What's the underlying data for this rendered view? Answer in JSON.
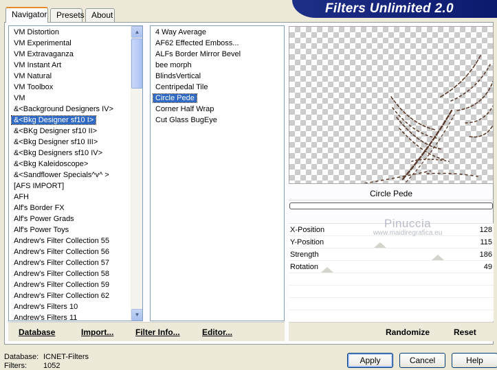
{
  "tabs": [
    {
      "label": "Navigator",
      "active": true
    },
    {
      "label": "Presets",
      "active": false
    },
    {
      "label": "About",
      "active": false
    }
  ],
  "banner": {
    "title": "Filters Unlimited 2.0"
  },
  "categories": [
    {
      "label": "VM Distortion"
    },
    {
      "label": "VM Experimental"
    },
    {
      "label": "VM Extravaganza"
    },
    {
      "label": "VM Instant Art"
    },
    {
      "label": "VM Natural"
    },
    {
      "label": "VM Toolbox"
    },
    {
      "label": "VM"
    },
    {
      "label": "&<Background Designers IV>"
    },
    {
      "label": "&<Bkg Designer sf10 I>",
      "selected": true
    },
    {
      "label": "&<BKg Designer sf10 II>"
    },
    {
      "label": "&<Bkg Designer sf10 III>"
    },
    {
      "label": "&<Bkg Designers sf10 IV>"
    },
    {
      "label": "&<Bkg Kaleidoscope>"
    },
    {
      "label": "&<Sandflower Specials^v^ >"
    },
    {
      "label": "[AFS IMPORT]"
    },
    {
      "label": "AFH"
    },
    {
      "label": "Alf's Border FX"
    },
    {
      "label": "Alf's Power Grads"
    },
    {
      "label": "Alf's Power Toys"
    },
    {
      "label": "Andrew's Filter Collection 55"
    },
    {
      "label": "Andrew's Filter Collection 56"
    },
    {
      "label": "Andrew's Filter Collection 57"
    },
    {
      "label": "Andrew's Filter Collection 58"
    },
    {
      "label": "Andrew's Filter Collection 59"
    },
    {
      "label": "Andrew's Filter Collection 62"
    },
    {
      "label": "Andrew's Filters 10"
    },
    {
      "label": "Andrew's Filters 11"
    }
  ],
  "filters": [
    {
      "label": "4 Way Average"
    },
    {
      "label": "AF62 Effected Emboss..."
    },
    {
      "label": "ALFs Border Mirror Bevel"
    },
    {
      "label": "bee morph"
    },
    {
      "label": "BlindsVertical"
    },
    {
      "label": "Centripedal Tile"
    },
    {
      "label": "Circle Pede",
      "selected": true
    },
    {
      "label": "Corner Half Wrap"
    },
    {
      "label": "Cut Glass  BugEye"
    }
  ],
  "preview": {
    "filter_name": "Circle Pede",
    "progress": 0
  },
  "params": [
    {
      "label": "X-Position",
      "value": "128"
    },
    {
      "label": "Y-Position",
      "value": "115"
    },
    {
      "label": "Strength",
      "value": "186"
    },
    {
      "label": "Rotation",
      "value": "49"
    }
  ],
  "watermark": {
    "line1": "Pinuccia",
    "line2": "www.maidiregrafica.eu"
  },
  "left_actions": {
    "database": "Database",
    "import": "Import...",
    "filter_info": "Filter Info...",
    "editor": "Editor..."
  },
  "right_actions": {
    "randomize": "Randomize",
    "reset": "Reset"
  },
  "footer": {
    "database_label": "Database:",
    "database_value": "ICNET-Filters",
    "filters_label": "Filters:",
    "filters_value": "1052"
  },
  "buttons": {
    "apply": "Apply",
    "cancel": "Cancel",
    "help": "Help"
  },
  "colors": {
    "selection": "#316ac5",
    "banner": "#0c1a6e",
    "tab_accent": "#e68b2c"
  },
  "icons": {
    "scroll_up": "chevron-up-icon",
    "scroll_down": "chevron-down-icon"
  }
}
